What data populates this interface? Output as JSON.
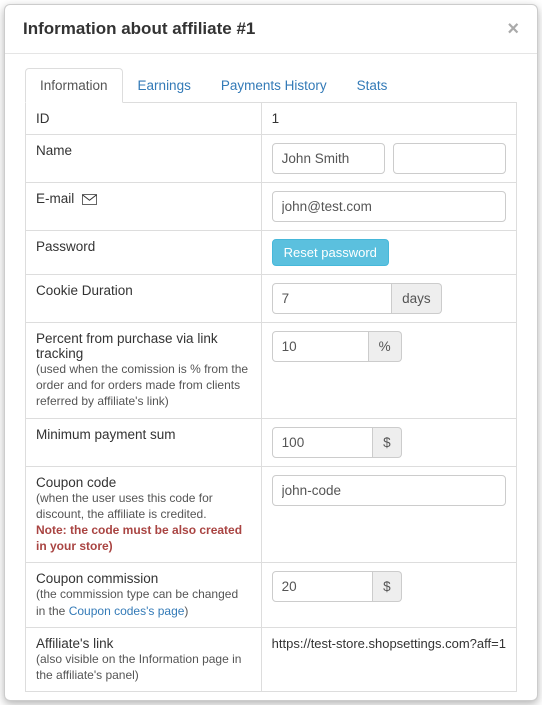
{
  "title": "Information about affiliate #1",
  "tabs": [
    "Information",
    "Earnings",
    "Payments History",
    "Stats"
  ],
  "rows": {
    "id": {
      "label": "ID",
      "value": "1"
    },
    "name": {
      "label": "Name",
      "first": "John Smith",
      "last": ""
    },
    "email": {
      "label": "E-mail",
      "value": "john@test.com"
    },
    "password": {
      "label": "Password",
      "button": "Reset password"
    },
    "cookie": {
      "label": "Cookie Duration",
      "value": "7",
      "unit": "days"
    },
    "percent": {
      "label": "Percent from purchase via link tracking",
      "help": "(used when the comission is % from the order and for orders made from clients referred by affiliate's link)",
      "value": "10",
      "unit": "%"
    },
    "minpay": {
      "label": "Minimum payment sum",
      "value": "100",
      "unit": "$"
    },
    "coupon": {
      "label": "Coupon code",
      "help1": "(when the user uses this code for discount, the affiliate is credited.",
      "help2": "Note: the code must be also created in your store)",
      "value": "john-code"
    },
    "couponComm": {
      "label": "Coupon commission",
      "helpPre": "(the commission type can be changed in the ",
      "helpLink": "Coupon codes's page",
      "helpPost": ")",
      "value": "20",
      "unit": "$"
    },
    "link": {
      "label": "Affiliate's link",
      "help": "(also visible on the Information page in the affiliate's panel)",
      "value": "https://test-store.shopsettings.com?aff=1"
    }
  }
}
